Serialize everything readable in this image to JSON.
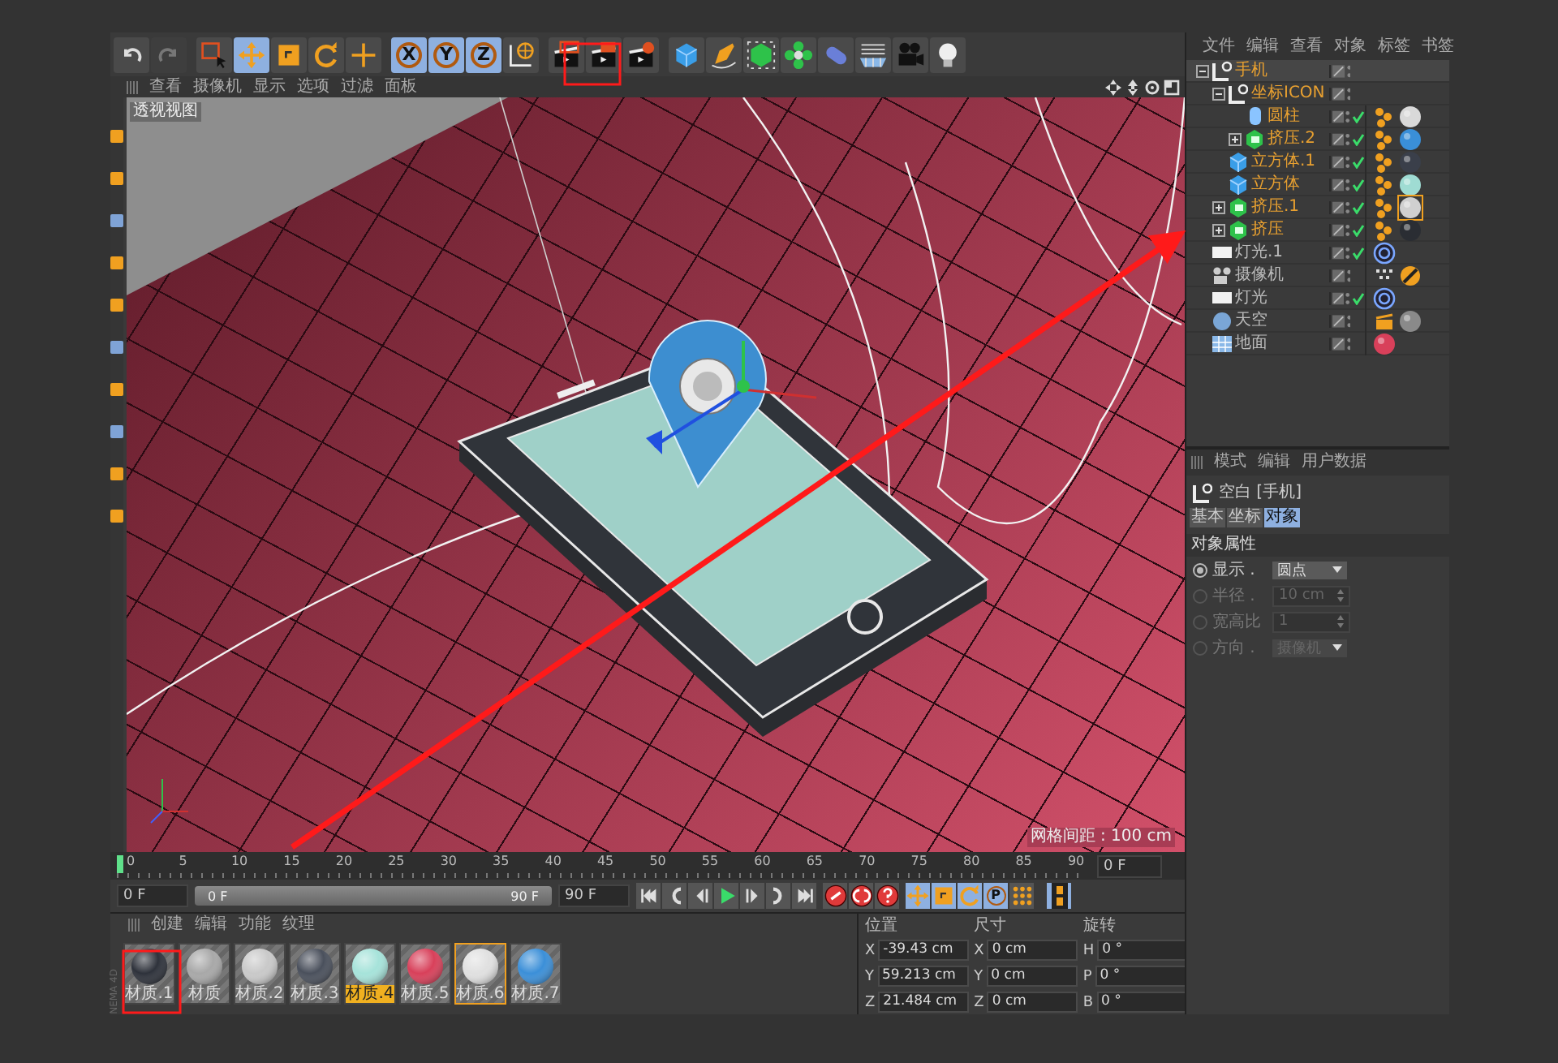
{
  "history": [
    {
      "kind": "undo",
      "disabled": false
    },
    {
      "kind": "redo",
      "disabled": true
    }
  ],
  "toolbar_groups": [
    [
      {
        "kind": "select",
        "selected": false
      },
      {
        "kind": "move",
        "selected": true
      },
      {
        "kind": "scale",
        "selected": false
      },
      {
        "kind": "rotate",
        "selected": false
      },
      {
        "kind": "add",
        "selected": false
      }
    ],
    [
      {
        "kind": "axis",
        "label": "X",
        "selected": true
      },
      {
        "kind": "axis",
        "label": "Y",
        "selected": true
      },
      {
        "kind": "axis",
        "label": "Z",
        "selected": true
      },
      {
        "kind": "world",
        "selected": false
      }
    ],
    [
      {
        "kind": "render-view",
        "selected": false
      },
      {
        "kind": "render-picture",
        "selected": false
      },
      {
        "kind": "render-settings",
        "selected": false
      }
    ],
    [
      {
        "kind": "cube",
        "selected": false
      },
      {
        "kind": "pen",
        "selected": false
      },
      {
        "kind": "nurbs",
        "selected": false
      },
      {
        "kind": "array",
        "selected": false
      },
      {
        "kind": "deformer",
        "selected": false
      },
      {
        "kind": "floor",
        "selected": false
      },
      {
        "kind": "camera",
        "selected": false
      },
      {
        "kind": "light",
        "selected": false
      }
    ]
  ],
  "viewport": {
    "menu": [
      "查看",
      "摄像机",
      "显示",
      "选项",
      "过滤",
      "面板"
    ],
    "nav_icons": [
      {
        "kind": "move"
      },
      {
        "kind": "zoom"
      },
      {
        "kind": "rotate"
      },
      {
        "kind": "maximize"
      }
    ],
    "view_label": "透视视图",
    "grid_info": "网格间距 : 100 cm"
  },
  "side_toolbar": [
    {
      "kind": "orange"
    },
    {
      "kind": "orange"
    },
    {
      "kind": "blue"
    },
    {
      "kind": "orange"
    },
    {
      "kind": "orange"
    },
    {
      "kind": "blue"
    },
    {
      "kind": "orange"
    },
    {
      "kind": "blue"
    },
    {
      "kind": "orange"
    },
    {
      "kind": "orange"
    }
  ],
  "timeline": {
    "ticks": [
      "0",
      "5",
      "10",
      "15",
      "20",
      "25",
      "30",
      "35",
      "40",
      "45",
      "50",
      "55",
      "60",
      "65",
      "70",
      "75",
      "80",
      "85",
      "90"
    ],
    "playhead": {
      "level": 0
    },
    "current_frame": "0 F"
  },
  "transport": {
    "start_field": "0 F",
    "range_start": "0 F",
    "range_end": "90 F",
    "range": {
      "level": 1
    },
    "end_field": "90 F",
    "playback": [
      {
        "kind": "to-start"
      },
      {
        "kind": "prev-key"
      },
      {
        "kind": "back"
      },
      {
        "kind": "play"
      },
      {
        "kind": "forward"
      },
      {
        "kind": "next-key"
      },
      {
        "kind": "to-end"
      }
    ],
    "record": [
      {
        "kind": "record"
      },
      {
        "kind": "auto-key"
      },
      {
        "kind": "keyframe-help"
      }
    ],
    "modes": [
      {
        "kind": "move",
        "selected": true
      },
      {
        "kind": "scale",
        "selected": true
      },
      {
        "kind": "rotate",
        "selected": true
      },
      {
        "kind": "param",
        "label": "P",
        "selected": true
      },
      {
        "kind": "points",
        "selected": false
      }
    ],
    "timeline_button": {
      "selected": true
    }
  },
  "materials": {
    "side_label": "NEMA 4D",
    "menu": [
      "创建",
      "编辑",
      "功能",
      "纹理"
    ],
    "items": [
      {
        "name": "材质.1",
        "color": "#2e323b",
        "selected": false,
        "active": false
      },
      {
        "name": "材质",
        "color": "#a8a8a8",
        "selected": false,
        "active": false
      },
      {
        "name": "材质.2",
        "color": "#c9c9c9",
        "selected": false,
        "active": false
      },
      {
        "name": "材质.3",
        "color": "#4a505c",
        "selected": false,
        "active": false
      },
      {
        "name": "材质.4",
        "color": "#a6e3da",
        "selected": true,
        "active": false
      },
      {
        "name": "材质.5",
        "color": "#d8405a",
        "selected": false,
        "active": false
      },
      {
        "name": "材质.6",
        "color": "#e0e0e0",
        "selected": false,
        "active": true
      },
      {
        "name": "材质.7",
        "color": "#3b8fd8",
        "selected": false,
        "active": false
      }
    ]
  },
  "coordinates": {
    "columns": [
      {
        "header": "位置",
        "rows": [
          {
            "axis": "X",
            "value": "-39.43 cm"
          },
          {
            "axis": "Y",
            "value": "59.213 cm"
          },
          {
            "axis": "Z",
            "value": "21.484 cm"
          }
        ]
      },
      {
        "header": "尺寸",
        "rows": [
          {
            "axis": "X",
            "value": "0 cm"
          },
          {
            "axis": "Y",
            "value": "0 cm"
          },
          {
            "axis": "Z",
            "value": "0 cm"
          }
        ]
      },
      {
        "header": "旋转",
        "rows": [
          {
            "axis": "H",
            "value": "0 °"
          },
          {
            "axis": "P",
            "value": "0 °"
          },
          {
            "axis": "B",
            "value": "0 °"
          }
        ]
      }
    ]
  },
  "object_manager": {
    "menu": [
      "文件",
      "编辑",
      "查看",
      "对象",
      "标签",
      "书签"
    ],
    "objects": [
      {
        "name": "手机",
        "kind": "null",
        "selected": true,
        "enabled": false,
        "expanded": true,
        "children": [
          {
            "name": "坐标ICON",
            "kind": "null",
            "selected": false,
            "enabled": false,
            "expanded": true,
            "children": [
              {
                "name": "圆柱",
                "kind": "cylinder",
                "selected": false,
                "enabled": true,
                "tags": [
                  {
                    "kind": "phong"
                  },
                  {
                    "kind": "material",
                    "color": "#d9d9d9",
                    "selected": false
                  }
                ]
              },
              {
                "name": "挤压.2",
                "kind": "extrude",
                "selected": false,
                "enabled": true,
                "expanded": false,
                "tags": [
                  {
                    "kind": "phong"
                  },
                  {
                    "kind": "material",
                    "color": "#3a8fd8",
                    "selected": false
                  }
                ]
              }
            ]
          },
          {
            "name": "立方体.1",
            "kind": "cube",
            "selected": false,
            "enabled": true,
            "tags": [
              {
                "kind": "phong"
              },
              {
                "kind": "material",
                "color": "#3a3f4a",
                "selected": false
              }
            ]
          },
          {
            "name": "立方体",
            "kind": "cube",
            "selected": false,
            "enabled": true,
            "tags": [
              {
                "kind": "phong"
              },
              {
                "kind": "material",
                "color": "#9fdcd3",
                "selected": false
              }
            ]
          },
          {
            "name": "挤压.1",
            "kind": "extrude",
            "selected": false,
            "enabled": true,
            "expanded": false,
            "tags": [
              {
                "kind": "phong"
              },
              {
                "kind": "material",
                "color": "#d0d0d0",
                "selected": true
              }
            ]
          },
          {
            "name": "挤压",
            "kind": "extrude",
            "selected": false,
            "enabled": true,
            "expanded": false,
            "tags": [
              {
                "kind": "phong"
              },
              {
                "kind": "material",
                "color": "#2a2d33",
                "selected": false
              }
            ]
          }
        ]
      },
      {
        "name": "灯光.1",
        "kind": "light",
        "selected": false,
        "enabled": true,
        "tags": [
          {
            "kind": "rings"
          }
        ]
      },
      {
        "name": "摄像机",
        "kind": "camera",
        "selected": false,
        "enabled": false,
        "tags": [
          {
            "kind": "protection"
          },
          {
            "kind": "target"
          }
        ]
      },
      {
        "name": "灯光",
        "kind": "light",
        "selected": false,
        "enabled": true,
        "tags": [
          {
            "kind": "rings"
          }
        ]
      },
      {
        "name": "天空",
        "kind": "sky",
        "selected": false,
        "enabled": false,
        "tags": [
          {
            "kind": "compositing"
          },
          {
            "kind": "material",
            "color": "#8a8a8a",
            "selected": false
          }
        ]
      },
      {
        "name": "地面",
        "kind": "floor",
        "selected": false,
        "enabled": false,
        "tags": [
          {
            "kind": "material",
            "color": "#d8405a",
            "selected": false
          }
        ]
      }
    ]
  },
  "attributes": {
    "menu": [
      "模式",
      "编辑",
      "用户数据"
    ],
    "title": "空白 [手机]",
    "tabs": [
      {
        "label": "基本",
        "selected": false
      },
      {
        "label": "坐标",
        "selected": false
      },
      {
        "label": "对象",
        "selected": true
      }
    ],
    "section": "对象属性",
    "fields": [
      {
        "label": "显示 .",
        "value": "圆点",
        "kind": "dropdown",
        "disabled": false
      },
      {
        "label": "半径 .",
        "value": "10 cm",
        "kind": "number",
        "disabled": true
      },
      {
        "label": "宽高比",
        "value": "1",
        "kind": "number",
        "disabled": true
      },
      {
        "label": "方向 .",
        "value": "摄像机",
        "kind": "dropdown",
        "disabled": true
      }
    ]
  }
}
